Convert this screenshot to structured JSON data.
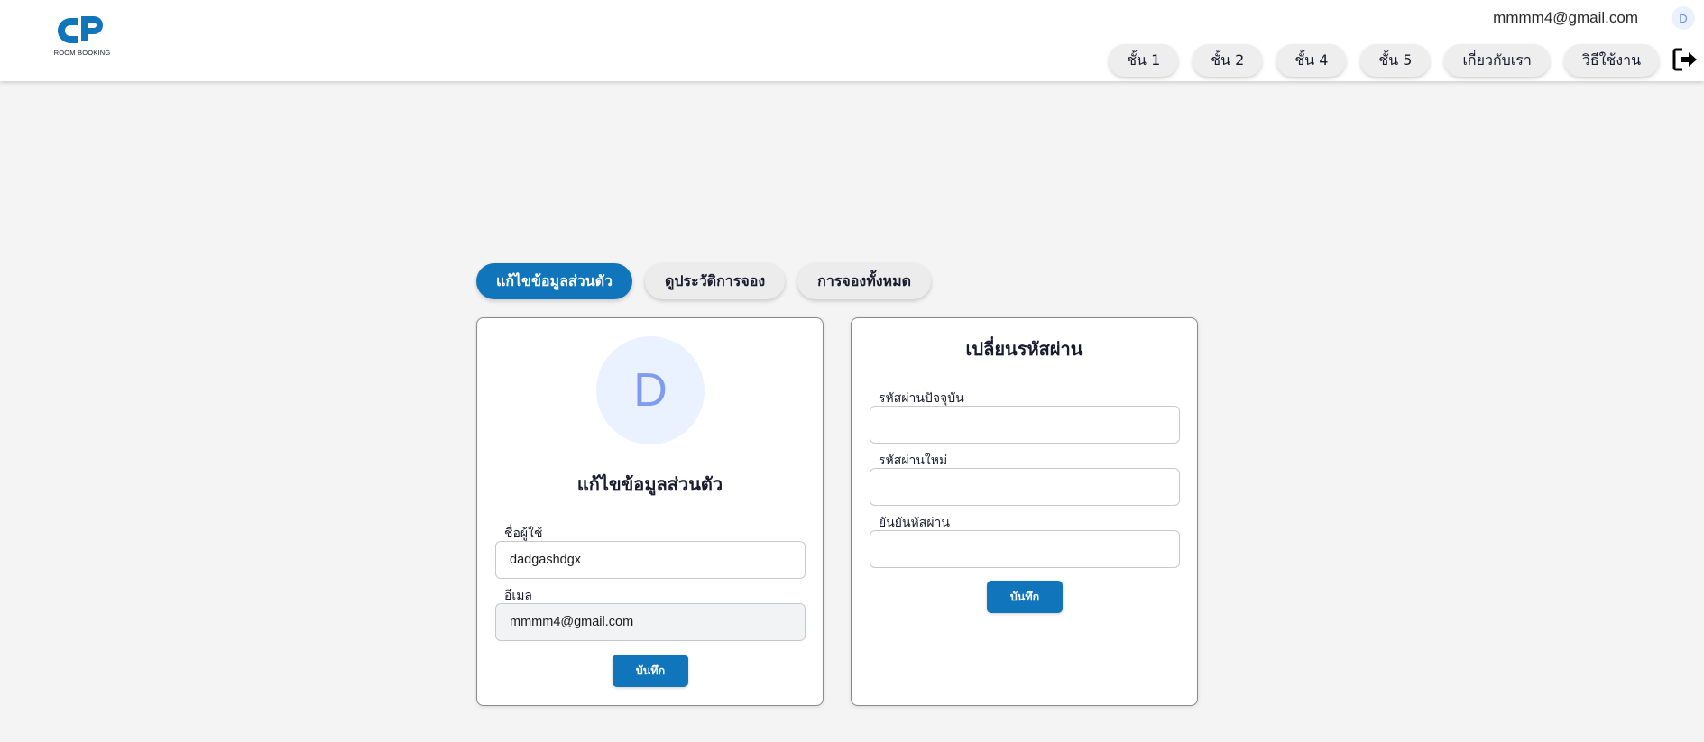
{
  "header": {
    "logo_text": "ROOM BOOKING",
    "user_email": "mmmm4@gmail.com",
    "user_avatar_letter": "D",
    "nav_items": [
      "ชั้น 1",
      "ชั้น 2",
      "ชั้น 4",
      "ชั้น 5",
      "เกี่ยวกับเรา",
      "วิธีใช้งาน"
    ],
    "logout_icon": "logout-icon"
  },
  "tabs": {
    "edit_profile": "แก้ไขข้อมูลส่วนตัว",
    "history": "ดูประวัติการจอง",
    "all_bookings": "การจองทั้งหมด"
  },
  "profile": {
    "avatar_letter": "D",
    "title": "แก้ไขข้อมูลส่วนตัว",
    "username_label": "ชื่อผู้ใช้",
    "username_value": "dadgashdgx",
    "email_label": "อีเมล",
    "email_value": "mmmm4@gmail.com",
    "save_label": "บันทึก"
  },
  "password": {
    "title": "เปลี่ยนรหัสผ่าน",
    "current_label": "รหัสผ่านปัจจุบัน",
    "current_value": "",
    "new_label": "รหัสผ่านใหม่",
    "new_value": "",
    "confirm_label": "ยันยันหัสผ่าน",
    "confirm_value": "",
    "save_label": "บันทึก"
  },
  "colors": {
    "primary": "#1175bb",
    "background": "#f4f4f4",
    "avatar_bg": "#eaf1ff",
    "avatar_fg": "#7f9cf0"
  }
}
